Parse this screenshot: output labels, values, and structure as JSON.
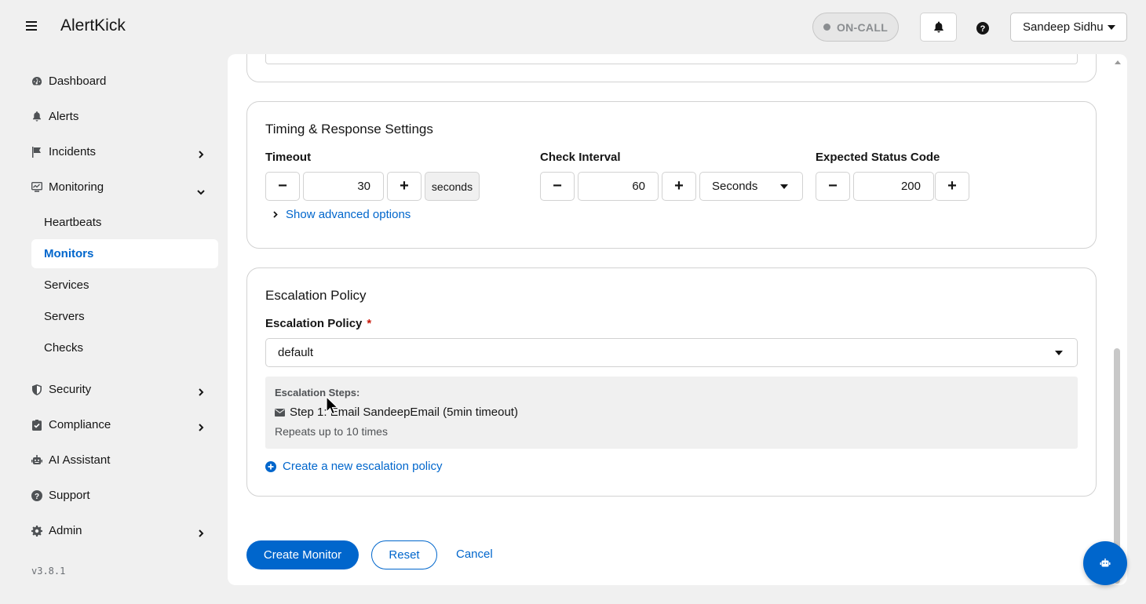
{
  "header": {
    "brand": "AlertKick",
    "oncall_label": "ON-CALL",
    "user_name": "Sandeep Sidhu"
  },
  "sidebar": {
    "items": [
      {
        "label": "Dashboard",
        "icon": "dashboard-icon"
      },
      {
        "label": "Alerts",
        "icon": "bell-icon"
      },
      {
        "label": "Incidents",
        "icon": "flag-icon"
      },
      {
        "label": "Monitoring",
        "icon": "monitor-icon"
      },
      {
        "label": "Security",
        "icon": "shield-icon"
      },
      {
        "label": "Compliance",
        "icon": "clipboard-check-icon"
      },
      {
        "label": "AI Assistant",
        "icon": "robot-icon"
      },
      {
        "label": "Support",
        "icon": "question-circle-icon"
      },
      {
        "label": "Admin",
        "icon": "gear-icon"
      }
    ],
    "monitoring_sub": [
      {
        "label": "Heartbeats"
      },
      {
        "label": "Monitors",
        "active": true
      },
      {
        "label": "Services"
      },
      {
        "label": "Servers"
      },
      {
        "label": "Checks"
      }
    ],
    "version": "v3.8.1"
  },
  "timing": {
    "title": "Timing & Response Settings",
    "timeout": {
      "label": "Timeout",
      "value": "30",
      "unit": "seconds"
    },
    "check_interval": {
      "label": "Check Interval",
      "value": "60",
      "unit": "Seconds"
    },
    "status_code": {
      "label": "Expected Status Code",
      "value": "200"
    },
    "advanced_toggle": "Show advanced options"
  },
  "escalation": {
    "title": "Escalation Policy",
    "field_label": "Escalation Policy",
    "required_mark": "*",
    "selected": "default",
    "steps_title": "Escalation Steps:",
    "step_1": "Step 1: Email SandeepEmail (5min timeout)",
    "repeats": "Repeats up to 10 times",
    "create_link": "Create a new escalation policy"
  },
  "actions": {
    "create": "Create Monitor",
    "reset": "Reset",
    "cancel": "Cancel"
  },
  "colors": {
    "accent": "#0066cc",
    "background": "#f0f0f0",
    "required": "#c9190b"
  }
}
